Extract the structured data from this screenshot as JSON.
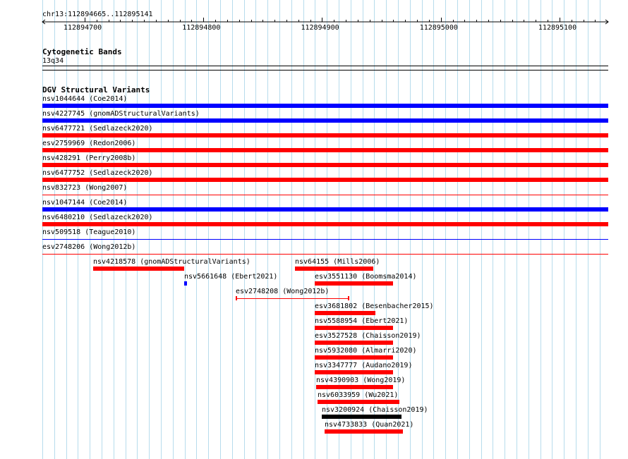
{
  "ruler": {
    "location": "chr13:112894665..112895141",
    "ticks": [
      {
        "label": "112894700",
        "pos": 112894700
      },
      {
        "label": "112894800",
        "pos": 112894800
      },
      {
        "label": "112894900",
        "pos": 112894900
      },
      {
        "label": "112895000",
        "pos": 112895000
      },
      {
        "label": "112895100",
        "pos": 112895100
      }
    ]
  },
  "cytoband": {
    "title": "Cytogenetic Bands",
    "band": "13q34"
  },
  "dgv": {
    "title": "DGV Structural Variants",
    "full_span": [
      {
        "label": "nsv1044644 (Coe2014)",
        "color": "#0000ff",
        "style": "thick"
      },
      {
        "label": "nsv4227745 (gnomADStructuralVariants)",
        "color": "#0000ff",
        "style": "thick"
      },
      {
        "label": "nsv6477721 (Sedlazeck2020)",
        "color": "#ff0000",
        "style": "thick"
      },
      {
        "label": "esv2759969 (Redon2006)",
        "color": "#ff0000",
        "style": "thick"
      },
      {
        "label": "nsv428291 (Perry2008b)",
        "color": "#ff0000",
        "style": "thick"
      },
      {
        "label": "nsv6477752 (Sedlazeck2020)",
        "color": "#ff0000",
        "style": "thick"
      },
      {
        "label": "nsv832723 (Wong2007)",
        "color": "#ff0000",
        "style": "thin"
      },
      {
        "label": "nsv1047144 (Coe2014)",
        "color": "#0000ff",
        "style": "thick"
      },
      {
        "label": "nsv6480210 (Sedlazeck2020)",
        "color": "#ff0000",
        "style": "thick"
      },
      {
        "label": "nsv509518 (Teague2010)",
        "color": "#0000ff",
        "style": "thin"
      },
      {
        "label": "esv2748206 (Wong2012b)",
        "color": "#ff0000",
        "style": "thin"
      }
    ],
    "partial": [
      {
        "label": "nsv4218578 (gnomADStructuralVariants)",
        "color": "#ff0000",
        "style": "thick",
        "start": 112894707,
        "end": 112894784
      },
      {
        "label": "nsv64155 (Mills2006)",
        "color": "#ff0000",
        "style": "thick",
        "start": 112894877,
        "end": 112894943
      },
      {
        "label": "nsv5661648 (Ebert2021)",
        "color": "#0000ff",
        "style": "thick",
        "start": 112894784,
        "end": 112894786
      },
      {
        "label": "esv3551130 (Boomsma2014)",
        "color": "#ff0000",
        "style": "thick",
        "start": 112894894,
        "end": 112894960
      },
      {
        "label": "esv2748208 (Wong2012b)",
        "color": "#ff0000",
        "style": "bracket",
        "start": 112894827,
        "end": 112894923
      },
      {
        "label": "esv3681802 (Besenbacher2015)",
        "color": "#ff0000",
        "style": "thick",
        "start": 112894894,
        "end": 112894945
      },
      {
        "label": "nsv5588954 (Ebert2021)",
        "color": "#ff0000",
        "style": "thick",
        "start": 112894894,
        "end": 112894960
      },
      {
        "label": "esv3527528 (Chaisson2019)",
        "color": "#ff0000",
        "style": "thick",
        "start": 112894894,
        "end": 112894960
      },
      {
        "label": "nsv5932080 (Almarri2020)",
        "color": "#ff0000",
        "style": "thick",
        "start": 112894894,
        "end": 112894960
      },
      {
        "label": "nsv3347777 (Audano2019)",
        "color": "#ff0000",
        "style": "thick",
        "start": 112894894,
        "end": 112894960
      },
      {
        "label": "nsv4390903 (Wong2019)",
        "color": "#ff0000",
        "style": "thick",
        "start": 112894895,
        "end": 112894960
      },
      {
        "label": "nsv6033959 (Wu2021)",
        "color": "#ff0000",
        "style": "thick",
        "start": 112894896,
        "end": 112894965
      },
      {
        "label": "nsv3200924 (Chaisson2019)",
        "color": "#000000",
        "style": "thick",
        "start": 112894900,
        "end": 112894967
      },
      {
        "label": "nsv4733833 (Quan2021)",
        "color": "#ff0000",
        "style": "thick",
        "start": 112894902,
        "end": 112894968
      }
    ]
  }
}
